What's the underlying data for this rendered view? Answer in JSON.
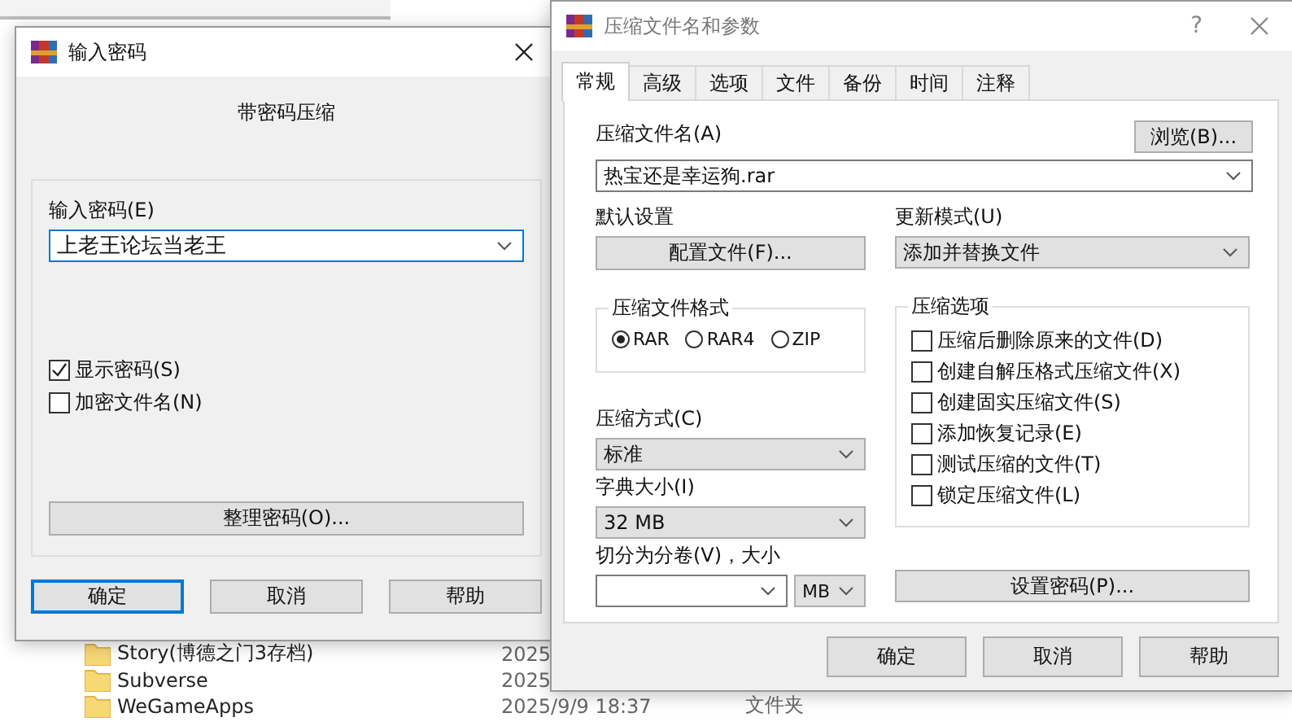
{
  "explorer": {
    "rows": [
      {
        "name": "Story(博德之门3存档)",
        "date": "2025"
      },
      {
        "name": "Subverse",
        "date": "2025"
      },
      {
        "name": "WeGameApps",
        "date": "2025/9/9 18:37",
        "type": "文件夹"
      }
    ]
  },
  "password_dialog": {
    "title": "输入密码",
    "subtitle": "带密码压缩",
    "field_label": "输入密码(E)",
    "password": "上老王论坛当老王",
    "checkboxes": [
      {
        "label": "显示密码(S)",
        "checked": true
      },
      {
        "label": "加密文件名(N)",
        "checked": false
      }
    ],
    "organize_button": "整理密码(O)...",
    "buttons": [
      {
        "label": "确定",
        "default": true
      },
      {
        "label": "取消",
        "default": false
      },
      {
        "label": "帮助",
        "default": false
      }
    ]
  },
  "archive_dialog": {
    "title": "压缩文件名和参数",
    "help": "?",
    "tabs": [
      {
        "label": "常规",
        "selected": true
      },
      {
        "label": "高级",
        "selected": false
      },
      {
        "label": "选项",
        "selected": false
      },
      {
        "label": "文件",
        "selected": false
      },
      {
        "label": "备份",
        "selected": false
      },
      {
        "label": "时间",
        "selected": false
      },
      {
        "label": "注释",
        "selected": false
      }
    ],
    "archive_name_label": "压缩文件名(A)",
    "browse_button": "浏览(B)...",
    "archive_name": "热宝还是幸运狗.rar",
    "profile_label": "默认设置",
    "profile_button": "配置文件(F)...",
    "update_mode_label": "更新模式(U)",
    "update_mode": "添加并替换文件",
    "format": {
      "title": "压缩文件格式",
      "options": [
        {
          "label": "RAR",
          "selected": true
        },
        {
          "label": "RAR4",
          "selected": false
        },
        {
          "label": "ZIP",
          "selected": false
        }
      ]
    },
    "method_label": "压缩方式(C)",
    "method": "标准",
    "dict_label": "字典大小(I)",
    "dict": "32 MB",
    "split_label": "切分为分卷(V)，大小",
    "split_unit": "MB",
    "options": {
      "title": "压缩选项",
      "checkboxes": [
        {
          "label": "压缩后删除原来的文件(D)",
          "checked": false
        },
        {
          "label": "创建自解压格式压缩文件(X)",
          "checked": false
        },
        {
          "label": "创建固实压缩文件(S)",
          "checked": false
        },
        {
          "label": "添加恢复记录(E)",
          "checked": false
        },
        {
          "label": "测试压缩的文件(T)",
          "checked": false
        },
        {
          "label": "锁定压缩文件(L)",
          "checked": false
        }
      ]
    },
    "set_password_button": "设置密码(P)...",
    "buttons": [
      {
        "label": "确定",
        "default": false
      },
      {
        "label": "取消",
        "default": false
      },
      {
        "label": "帮助",
        "default": false
      }
    ]
  }
}
